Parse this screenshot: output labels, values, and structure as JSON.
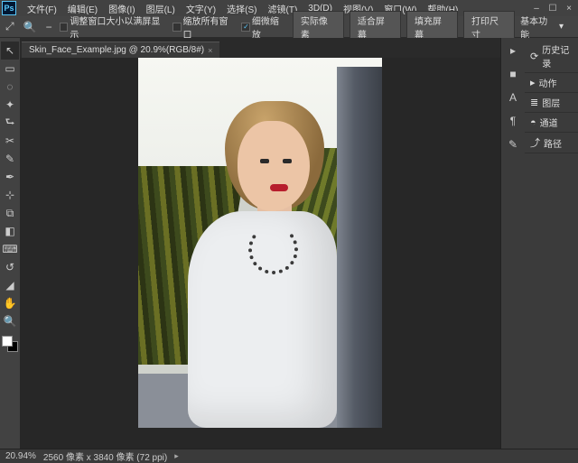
{
  "app_logo": "Ps",
  "menu": [
    "文件(F)",
    "编辑(E)",
    "图像(I)",
    "图层(L)",
    "文字(Y)",
    "选择(S)",
    "滤镜(T)",
    "3D(D)",
    "视图(V)",
    "窗口(W)",
    "帮助(H)"
  ],
  "options": {
    "tool_hint": "⤢",
    "zoom_icon": "🔍",
    "check_fit": {
      "label": "调整窗口大小以满屏显示",
      "checked": false
    },
    "check_allwin": {
      "label": "缩放所有窗口",
      "checked": false
    },
    "check_scrubby": {
      "label": "细微缩放",
      "checked": true
    },
    "btn_actual": "实际像素",
    "btn_fit": "适合屏幕",
    "btn_fill": "填充屏幕",
    "btn_print": "打印尺寸",
    "workspace": "基本功能"
  },
  "document": {
    "tab_label": "Skin_Face_Example.jpg @ 20.9%(RGB/8#)",
    "close_glyph": "×"
  },
  "tools": [
    "↖",
    "▭",
    "◌",
    "✦",
    "⮑",
    "✂",
    "✎",
    "✒",
    "⊹",
    "⧉",
    "◧",
    "⌨",
    "↺",
    "◢",
    "✋",
    "🔍"
  ],
  "panel_icons": [
    "▸",
    "■",
    "A",
    "¶",
    "✎"
  ],
  "panel_tabs": [
    {
      "icon": "⟳",
      "label": "历史记录"
    },
    {
      "icon": "▸",
      "label": "动作"
    },
    {
      "icon": "≣",
      "label": "图层"
    },
    {
      "icon": "◓",
      "label": "通道"
    },
    {
      "icon": "⤴",
      "label": "路径"
    }
  ],
  "status": {
    "zoom": "20.94%",
    "dimensions": "2560 像素 x 3840 像素 (72 ppi)"
  }
}
